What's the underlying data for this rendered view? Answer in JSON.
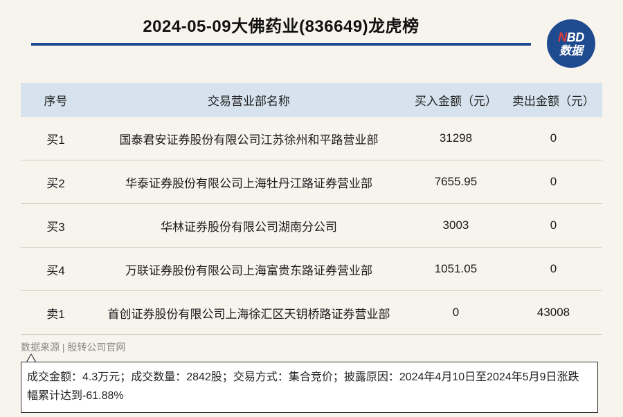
{
  "header": {
    "title": "2024-05-09大佛药业(836649)龙虎榜",
    "logo_top_n": "N",
    "logo_top_rest": "BD",
    "logo_bottom": "数据"
  },
  "table": {
    "headers": [
      "序号",
      "交易营业部名称",
      "买入金额（元）",
      "卖出金额（元）"
    ],
    "rows": [
      {
        "seq": "买1",
        "name": "国泰君安证券股份有限公司江苏徐州和平路营业部",
        "buy": "31298",
        "sell": "0"
      },
      {
        "seq": "买2",
        "name": "华泰证券股份有限公司上海牡丹江路证券营业部",
        "buy": "7655.95",
        "sell": "0"
      },
      {
        "seq": "买3",
        "name": "华林证券股份有限公司湖南分公司",
        "buy": "3003",
        "sell": "0"
      },
      {
        "seq": "买4",
        "name": "万联证券股份有限公司上海富贵东路证券营业部",
        "buy": "1051.05",
        "sell": "0"
      },
      {
        "seq": "卖1",
        "name": "首创证券股份有限公司上海徐汇区天钥桥路证券营业部",
        "buy": "0",
        "sell": "43008"
      }
    ]
  },
  "footer": {
    "source": "数据来源 | 股转公司官网",
    "note": "成交金额：4.3万元；成交数量：2842股；交易方式：集合竞价；披露原因：2024年4月10日至2024年5月9日涨跌幅累计达到-61.88%"
  },
  "colors": {
    "accent": "#1e4b8f",
    "header_bg": "#d6e3ef",
    "page_bg": "#f7f4ee",
    "logo_n": "#e23a3a"
  }
}
